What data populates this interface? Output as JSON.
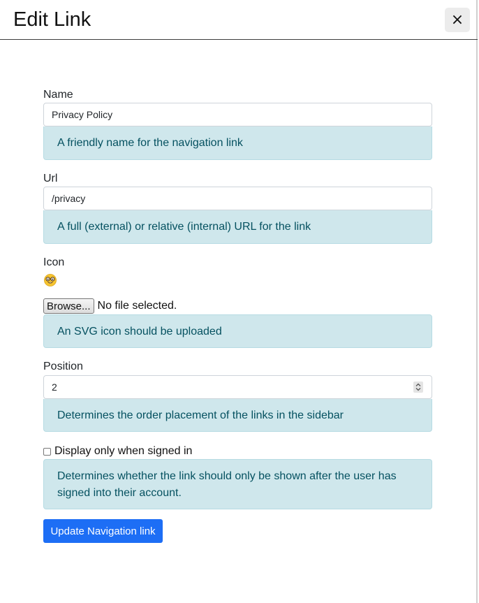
{
  "modal": {
    "title": "Edit Link",
    "close_label": "×"
  },
  "fields": {
    "name": {
      "label": "Name",
      "value": "Privacy Policy",
      "help": "A friendly name for the navigation link"
    },
    "url": {
      "label": "Url",
      "value": "/privacy",
      "help": "A full (external) or relative (internal) URL for the link"
    },
    "icon": {
      "label": "Icon",
      "current_icon": "nerd-face-emoji-icon",
      "browse_label": "Browse...",
      "file_status": "No file selected.",
      "help": "An SVG icon should be uploaded"
    },
    "position": {
      "label": "Position",
      "value": "2",
      "help": "Determines the order placement of the links in the sidebar"
    },
    "signed_in": {
      "label": "Display only when signed in",
      "checked": false,
      "help": "Determines whether the link should only be shown after the user has signed into their account."
    }
  },
  "submit_label": "Update Navigation link",
  "colors": {
    "accent": "#1d6ef5",
    "help_bg": "#cfe7ec",
    "help_text": "#055160"
  }
}
